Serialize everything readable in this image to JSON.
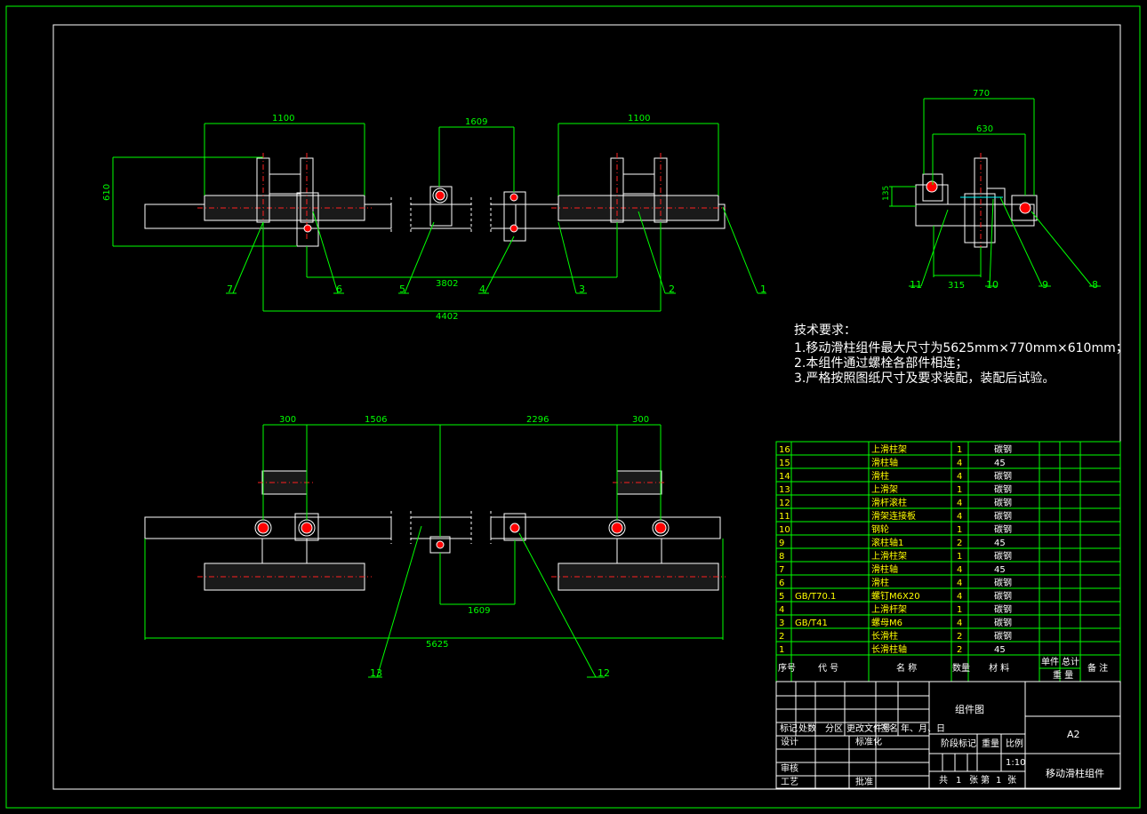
{
  "tech_requirements": {
    "heading": "技术要求：",
    "items": [
      "1.移动滑柱组件最大尺寸为5625mm×770mm×610mm；",
      "2.本组件通过螺栓各部件相连；",
      "3.严格按照图纸尺寸及要求装配，装配后试验。"
    ]
  },
  "front_view": {
    "dims": {
      "d1100_left": "1100",
      "d1609_top": "1609",
      "d1100_right": "1100",
      "d610": "610",
      "d3802": "3802",
      "d4402": "4402"
    },
    "balloons": [
      "1",
      "2",
      "3",
      "4",
      "5",
      "6",
      "7"
    ]
  },
  "side_view": {
    "dims": {
      "d770": "770",
      "d630": "630",
      "d135": "135",
      "d315": "315"
    },
    "balloons": [
      "8",
      "9",
      "10",
      "11"
    ]
  },
  "top_view": {
    "dims": {
      "d300_left": "300",
      "d1506": "1506",
      "d2296": "2296",
      "d300_right": "300",
      "d1609_bottom": "1609",
      "d5625": "5625"
    },
    "balloons": [
      "12",
      "13"
    ]
  },
  "bom": {
    "rows": [
      {
        "no": "16",
        "code": "",
        "name": "上滑柱架",
        "qty": "1",
        "mat": "碳钢"
      },
      {
        "no": "15",
        "code": "",
        "name": "滑柱轴",
        "qty": "4",
        "mat": "45"
      },
      {
        "no": "14",
        "code": "",
        "name": "滑柱",
        "qty": "4",
        "mat": "碳钢"
      },
      {
        "no": "13",
        "code": "",
        "name": "上滑架",
        "qty": "1",
        "mat": "碳钢"
      },
      {
        "no": "12",
        "code": "",
        "name": "滑杆滚柱",
        "qty": "4",
        "mat": "碳钢"
      },
      {
        "no": "11",
        "code": "",
        "name": "滑架连接板",
        "qty": "4",
        "mat": "碳钢"
      },
      {
        "no": "10",
        "code": "",
        "name": "钢轮",
        "qty": "1",
        "mat": "碳钢"
      },
      {
        "no": "9",
        "code": "",
        "name": "滚柱轴1",
        "qty": "2",
        "mat": "45"
      },
      {
        "no": "8",
        "code": "",
        "name": "上滑柱架",
        "qty": "1",
        "mat": "碳钢"
      },
      {
        "no": "7",
        "code": "",
        "name": "滑柱轴",
        "qty": "4",
        "mat": "45"
      },
      {
        "no": "6",
        "code": "",
        "name": "滑柱",
        "qty": "4",
        "mat": "碳钢"
      },
      {
        "no": "5",
        "code": "GB/T70.1",
        "name": "螺钉M6X20",
        "qty": "4",
        "mat": "碳钢"
      },
      {
        "no": "4",
        "code": "",
        "name": "上滑杆架",
        "qty": "1",
        "mat": "碳钢"
      },
      {
        "no": "3",
        "code": "GB/T41",
        "name": "螺母M6",
        "qty": "4",
        "mat": "碳钢"
      },
      {
        "no": "2",
        "code": "",
        "name": "长滑柱",
        "qty": "2",
        "mat": "碳钢"
      },
      {
        "no": "1",
        "code": "",
        "name": "长滑柱轴",
        "qty": "2",
        "mat": "45"
      }
    ],
    "header": {
      "no": "序号",
      "code": "代  号",
      "name": "名  称",
      "qty": "数量",
      "mat": "材  料",
      "unit": "单件",
      "total": "总计",
      "weight": "重  量",
      "remark": "备  注"
    }
  },
  "title_block": {
    "drawing_title": "组件图",
    "size": "A2",
    "part_name": "移动滑柱组件",
    "scale": "1:10",
    "labels": {
      "mark": "标记",
      "count": "处数",
      "zone": "分区",
      "change_doc": "更改文件号",
      "sign": "签名",
      "date": "年、月、日",
      "design": "设计",
      "standardize": "标准化",
      "stage_mark": "阶段标记",
      "weight": "重量",
      "ratio": "比例",
      "review": "审核",
      "process": "工艺",
      "approve": "批准",
      "total": "共",
      "sheets": "张",
      "sheet_no": "第",
      "one": "1"
    }
  }
}
